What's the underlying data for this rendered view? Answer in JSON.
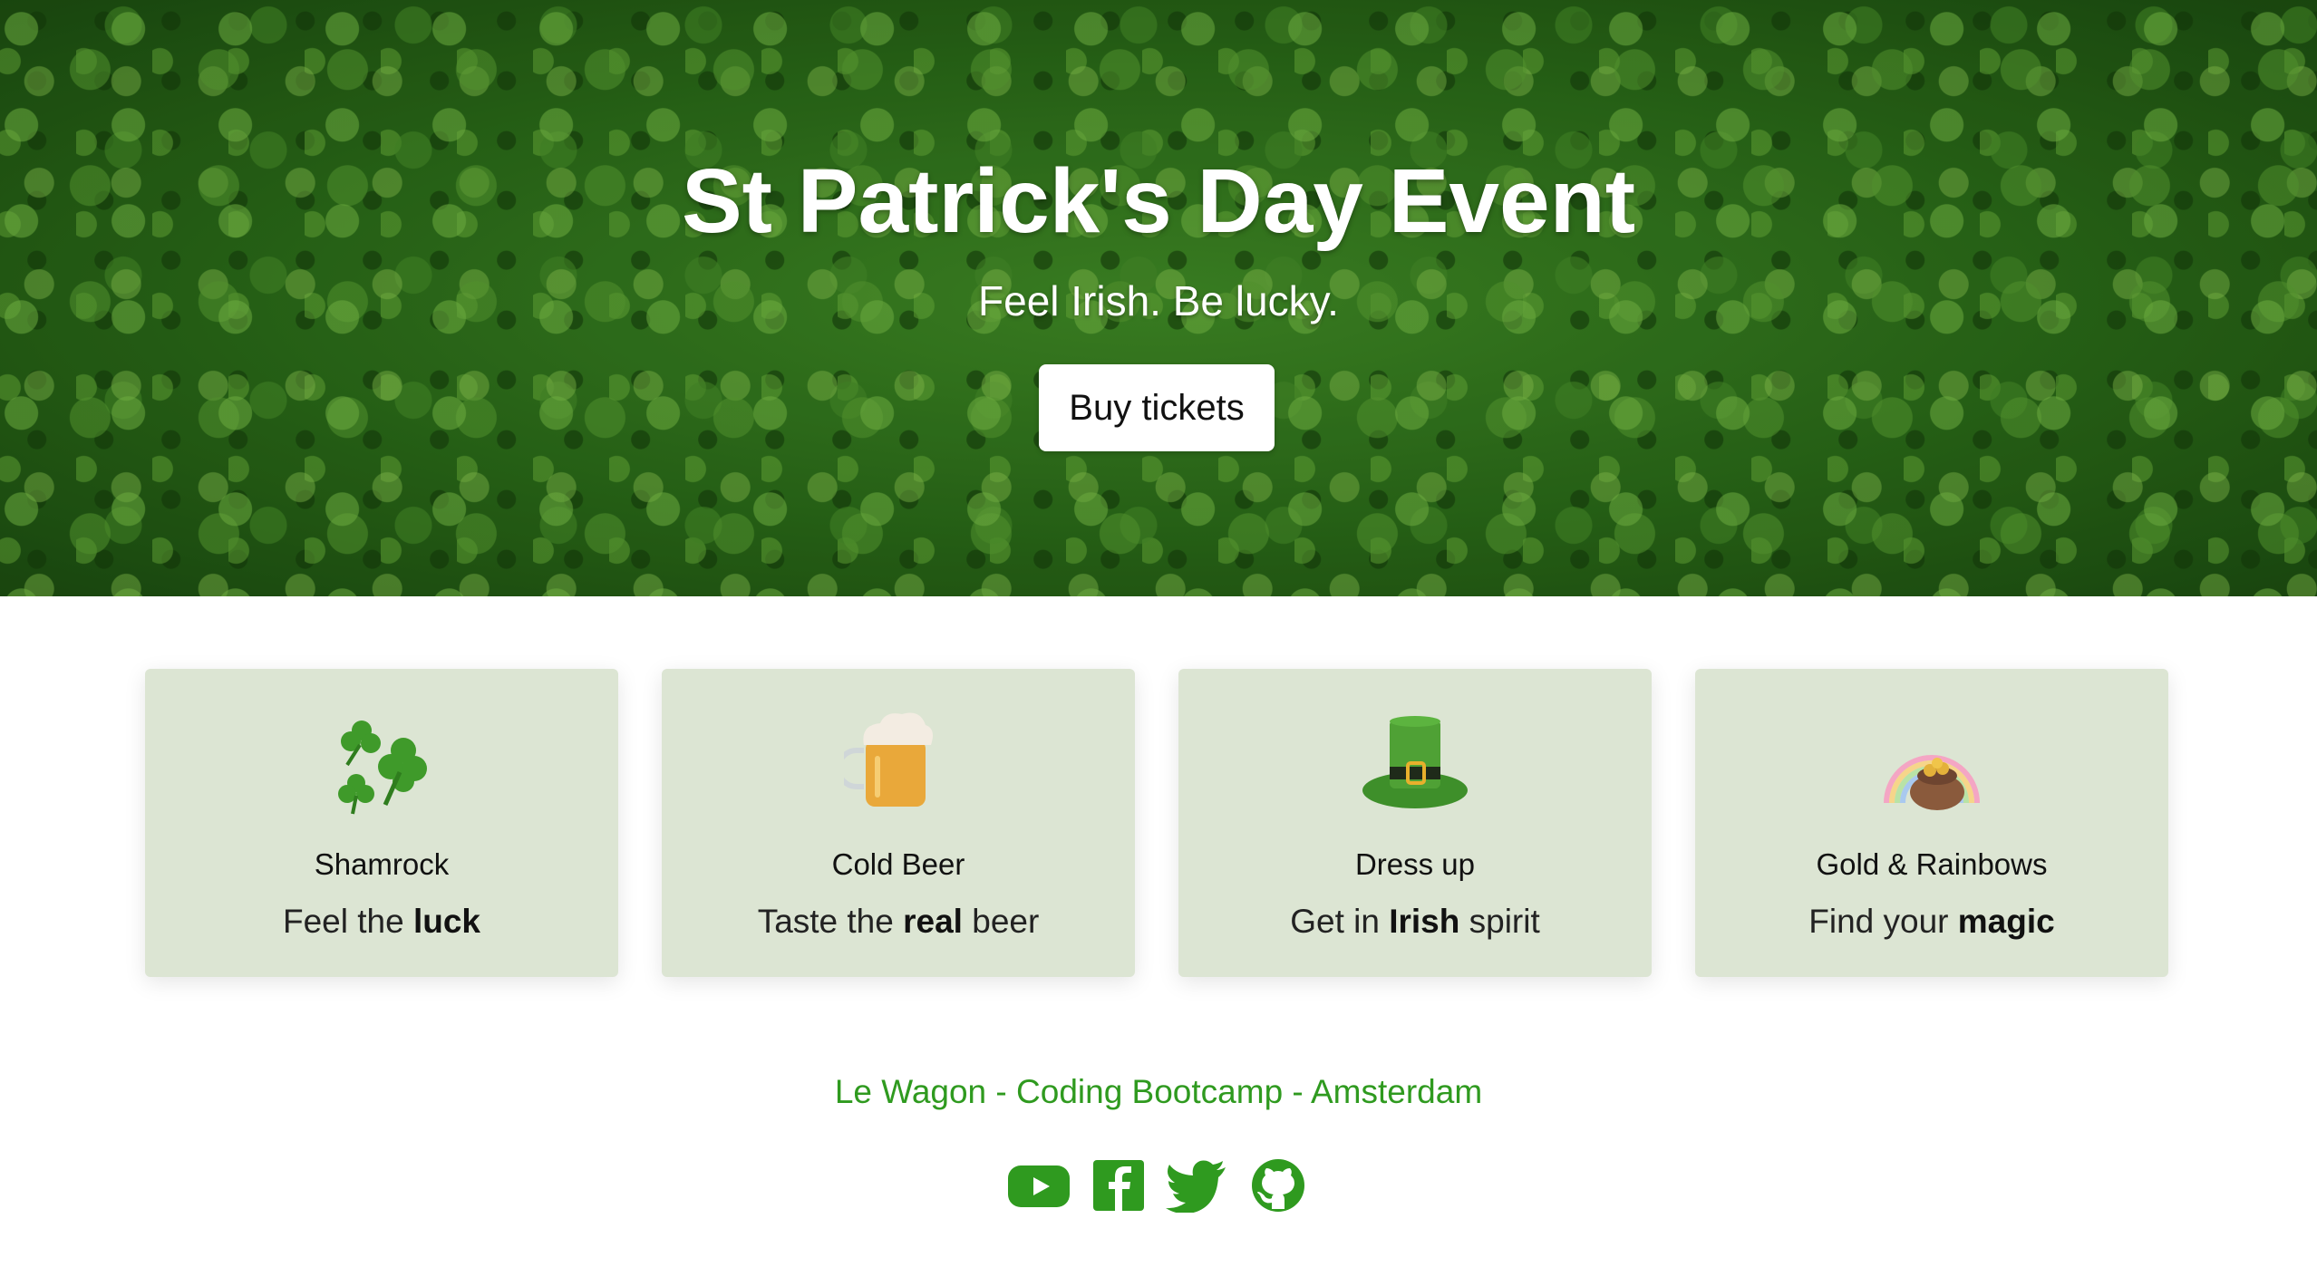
{
  "hero": {
    "title": "St Patrick's Day Event",
    "subtitle": "Feel Irish. Be lucky.",
    "button_label": "Buy tickets"
  },
  "cards": [
    {
      "icon": "shamrock-icon",
      "title": "Shamrock",
      "text_before": "Feel the ",
      "text_bold": "luck",
      "text_after": ""
    },
    {
      "icon": "beer-mug-icon",
      "title": "Cold Beer",
      "text_before": "Taste the ",
      "text_bold": "real",
      "text_after": " beer"
    },
    {
      "icon": "leprechaun-hat-icon",
      "title": "Dress up",
      "text_before": "Get in ",
      "text_bold": "Irish",
      "text_after": " spirit"
    },
    {
      "icon": "rainbow-gold-icon",
      "title": "Gold & Rainbows",
      "text_before": "Find your ",
      "text_bold": "magic",
      "text_after": ""
    }
  ],
  "footer": {
    "text": "Le Wagon - Coding Bootcamp - Amsterdam",
    "socials": [
      "youtube-icon",
      "facebook-icon",
      "twitter-icon",
      "github-icon"
    ]
  },
  "colors": {
    "accent_green": "#2f9a1f",
    "card_background": "#dce5d3",
    "hero_green": "#2a6a18"
  }
}
